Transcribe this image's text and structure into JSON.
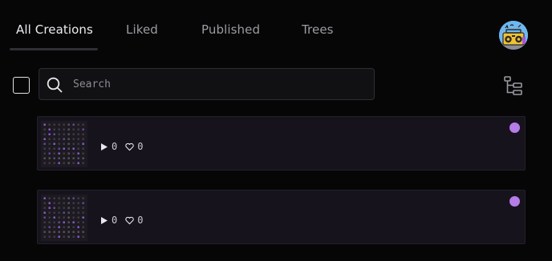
{
  "tabs": [
    {
      "label": "All Creations",
      "active": true
    },
    {
      "label": "Liked",
      "active": false
    },
    {
      "label": "Published",
      "active": false
    },
    {
      "label": "Trees",
      "active": false
    }
  ],
  "search": {
    "placeholder": "Search",
    "value": ""
  },
  "icons": {
    "search": "search-icon",
    "tree_view": "tree-view-icon",
    "play": "play-icon",
    "like": "heart-icon",
    "avatar": "boombox-avatar"
  },
  "creations": [
    {
      "plays": "0",
      "likes": "0",
      "status_color": "#b67ce8"
    },
    {
      "plays": "0",
      "likes": "0",
      "status_color": "#b67ce8"
    }
  ],
  "colors": {
    "background": "#060607",
    "card": "#17131d",
    "accent": "#b67ce8",
    "avatar_bg": "#6fb8ef"
  }
}
